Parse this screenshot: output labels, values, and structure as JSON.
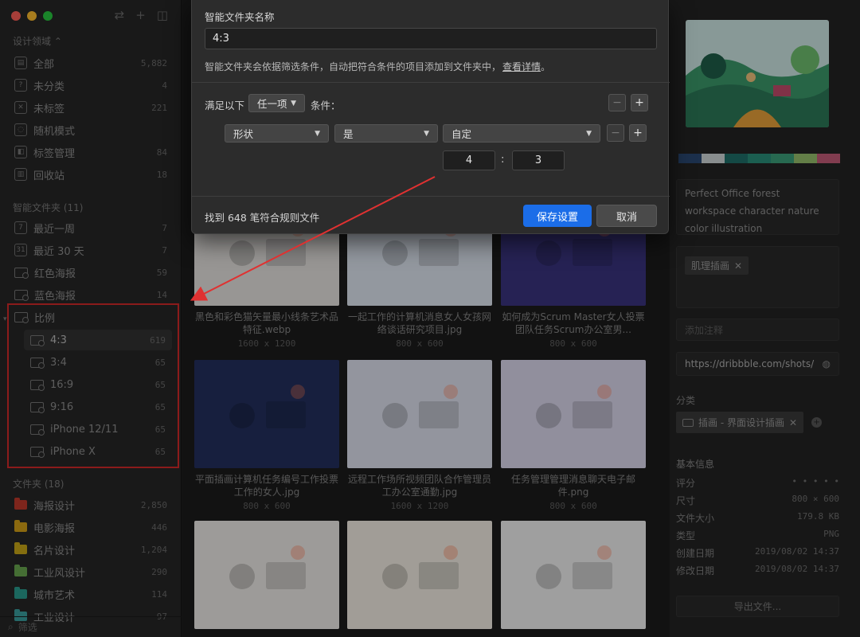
{
  "sidebar": {
    "library_title": "设计领域 ⌃",
    "library_items": [
      {
        "label": "全部",
        "count": "5,882",
        "icon": "grid-icon"
      },
      {
        "label": "未分类",
        "count": "4",
        "icon": "question-icon"
      },
      {
        "label": "未标签",
        "count": "221",
        "icon": "untagged-icon"
      },
      {
        "label": "随机模式",
        "count": "",
        "icon": "bulb-icon"
      },
      {
        "label": "标签管理",
        "count": "84",
        "icon": "tag-icon"
      },
      {
        "label": "回收站",
        "count": "18",
        "icon": "trash-icon"
      }
    ],
    "smart_title": "智能文件夹 (11)",
    "smart_items": [
      {
        "label": "最近一周",
        "count": "7",
        "icon": "calendar-7-icon"
      },
      {
        "label": "最近 30 天",
        "count": "7",
        "icon": "calendar-31-icon"
      },
      {
        "label": "红色海报",
        "count": "59",
        "icon": "smart-folder-icon"
      },
      {
        "label": "蓝色海报",
        "count": "14",
        "icon": "smart-folder-icon"
      },
      {
        "label": "比例",
        "count": "",
        "icon": "smart-folder-icon"
      }
    ],
    "ratio_children": [
      {
        "label": "4:3",
        "count": "619"
      },
      {
        "label": "3:4",
        "count": "65"
      },
      {
        "label": "16:9",
        "count": "65"
      },
      {
        "label": "9:16",
        "count": "65"
      },
      {
        "label": "iPhone 12/11",
        "count": "65"
      },
      {
        "label": "iPhone X",
        "count": "65"
      }
    ],
    "folders_title": "文件夹 (18)",
    "folder_items": [
      {
        "label": "海报设计",
        "count": "2,850",
        "color": "#c0392b"
      },
      {
        "label": "电影海报",
        "count": "446",
        "color": "#d4a017"
      },
      {
        "label": "名片设计",
        "count": "1,204",
        "color": "#c9a818"
      },
      {
        "label": "工业风设计",
        "count": "290",
        "color": "#6aa84f"
      },
      {
        "label": "城市艺术",
        "count": "114",
        "color": "#2a9d8f"
      },
      {
        "label": "工业设计",
        "count": "97",
        "color": "#3aa0a0"
      }
    ],
    "filter_placeholder": "筛选"
  },
  "main": {
    "cards": [
      {
        "caption": "黑色和彩色猫矢量最小线条艺术品特征.webp",
        "dims": "1600 x 1200",
        "bg": "#e7e4e1"
      },
      {
        "caption": "一起工作的计算机消息女人女孩网络谈话研究项目.jpg",
        "dims": "800 x 600",
        "bg": "#dfe7f2"
      },
      {
        "caption": "如何成为Scrum Master女人投票团队任务Scrum办公室男...",
        "dims": "800 x 600",
        "bg": "#3a3580"
      },
      {
        "caption": "平面插画计算机任务编号工作投票工作的女人.jpg",
        "dims": "800 x 600",
        "bg": "#23305f"
      },
      {
        "caption": "远程工作场所视频团队合作管理员工办公室通勤.jpg",
        "dims": "1600 x 1200",
        "bg": "#dfe3f0"
      },
      {
        "caption": "任务管理管理消息聊天电子邮件.png",
        "dims": "800 x 600",
        "bg": "#dcd9ee"
      },
      {
        "caption": "",
        "dims": "",
        "bg": "#efece8"
      },
      {
        "caption": "",
        "dims": "",
        "bg": "#f4efe5"
      },
      {
        "caption": "",
        "dims": "",
        "bg": "#f2f2f2"
      }
    ]
  },
  "inspector": {
    "palette": [
      "#2b4a74",
      "#cfd7d8",
      "#1f6f6a",
      "#2a8f7a",
      "#3ca07a",
      "#97bf6c",
      "#c45c78"
    ],
    "description": "Perfect Office forest workspace character nature color illustration",
    "tag": "肌理插画",
    "note_placeholder": "添加注释",
    "url": "https://dribbble.com/shots/",
    "category_title": "分类",
    "category": "插画 - 界面设计插画",
    "info_title": "基本信息",
    "info": [
      {
        "k": "评分",
        "v": "• • • • •"
      },
      {
        "k": "尺寸",
        "v": "800 × 600"
      },
      {
        "k": "文件大小",
        "v": "179.8 KB"
      },
      {
        "k": "类型",
        "v": "PNG"
      },
      {
        "k": "创建日期",
        "v": "2019/08/02 14:37"
      },
      {
        "k": "修改日期",
        "v": "2019/08/02 14:37"
      }
    ],
    "export_label": "导出文件..."
  },
  "dialog": {
    "name_label": "智能文件夹名称",
    "name_value": "4:3",
    "description": "智能文件夹会依据筛选条件，自动把符合条件的项目添加到文件夹中，",
    "details_link": "查看详情",
    "period": "。",
    "match_prefix": "满足以下",
    "match_mode": "任一项",
    "match_suffix": "条件：",
    "rule_field": "形状",
    "rule_op": "是",
    "rule_value": "自定",
    "ratio_w": "4",
    "ratio_colon": ":",
    "ratio_h": "3",
    "found_text": "找到 648 笔符合规则文件",
    "save_label": "保存设置",
    "cancel_label": "取消",
    "minus": "−",
    "plus": "+"
  }
}
